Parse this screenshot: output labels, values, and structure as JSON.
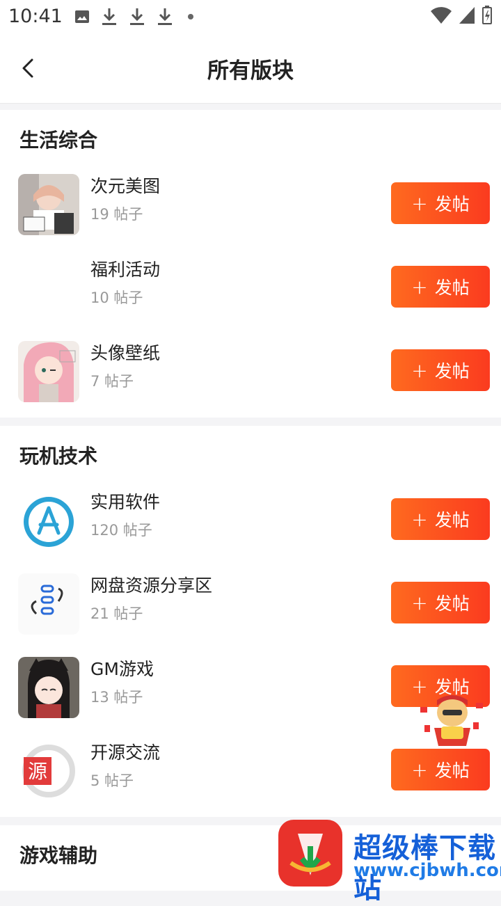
{
  "status": {
    "time": "10:41"
  },
  "header": {
    "title": "所有版块"
  },
  "post_label": "发帖",
  "sections": [
    {
      "title": "生活综合",
      "items": [
        {
          "name": "次元美图",
          "count": "19 帖子"
        },
        {
          "name": "福利活动",
          "count": "10 帖子"
        },
        {
          "name": "头像壁纸",
          "count": "7 帖子"
        }
      ]
    },
    {
      "title": "玩机技术",
      "items": [
        {
          "name": "实用软件",
          "count": "120 帖子"
        },
        {
          "name": "网盘资源分享区",
          "count": "21 帖子"
        },
        {
          "name": "GM游戏",
          "count": "13 帖子"
        },
        {
          "name": "开源交流",
          "count": "5 帖子"
        }
      ]
    },
    {
      "title": "游戏辅助"
    }
  ],
  "watermark": {
    "name": "超级棒下载站",
    "url": "www.cjbwh.com"
  },
  "colors": {
    "accent_start": "#fe6a1f",
    "accent_end": "#fb3b1f"
  }
}
